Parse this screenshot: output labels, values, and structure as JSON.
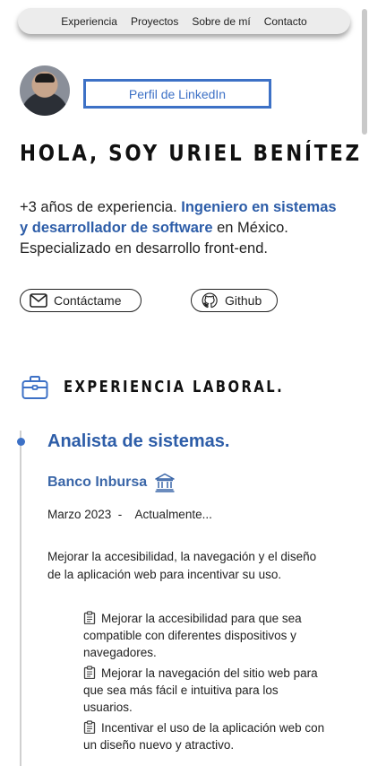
{
  "nav": {
    "items": [
      "Experiencia",
      "Proyectos",
      "Sobre de mí",
      "Contacto"
    ]
  },
  "profile": {
    "linkedin_label": "Perfil de LinkedIn",
    "headline": "HOLA, SOY URIEL BENÍTEZ",
    "intro_prefix": "+3 años de experiencia. ",
    "intro_highlight": "Ingeniero en sistemas y desarrollador de software",
    "intro_suffix": " en México. Especializado en desarrollo front-end.",
    "contact_label": "Contáctame",
    "github_label": "Github"
  },
  "experience": {
    "section_title": "EXPERIENCIA LABORAL.",
    "jobs": [
      {
        "title": "Analista de sistemas.",
        "company": "Banco Inbursa",
        "dates": "Marzo 2023  -    Actualmente...",
        "description": "Mejorar la accesibilidad, la navegación y el diseño de la aplicación web para incentivar su uso.",
        "bullets": [
          "Mejorar la accesibilidad para que sea compatible con diferentes dispositivos y navegadores.",
          "Mejorar la navegación del sitio web para que sea más fácil e intuitiva para los usuarios.",
          "Incentivar el uso de la aplicación web con un diseño nuevo y atractivo."
        ]
      }
    ]
  },
  "colors": {
    "accent": "#3d71c6",
    "highlight_text": "#2d5da8",
    "nav_bg": "#ececec"
  },
  "icons": [
    "mail-icon",
    "github-icon",
    "briefcase-icon",
    "bank-icon",
    "clipboard-icon"
  ]
}
